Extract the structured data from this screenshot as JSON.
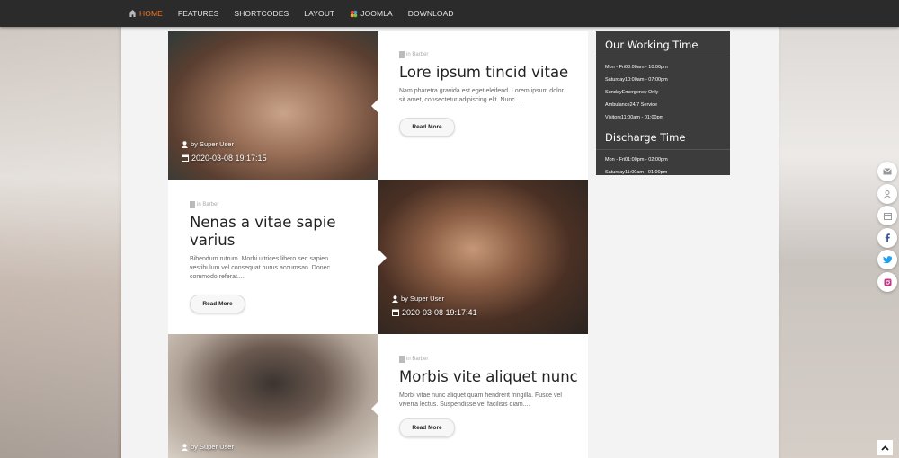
{
  "nav": {
    "items": [
      {
        "label": "HOME",
        "active": true
      },
      {
        "label": "FEATURES"
      },
      {
        "label": "SHORTCODES"
      },
      {
        "label": "LAYOUT"
      },
      {
        "label": "JOOMLA"
      },
      {
        "label": "DOWNLOAD"
      }
    ]
  },
  "posts": [
    {
      "category": "in Barber",
      "title": "Lore ipsum tincid vitae",
      "excerpt": "Nam pharetra gravida est eget eleifend. Lorem ipsum dolor sit amet, consectetur adipiscing elit. Nunc....",
      "button": "Read More",
      "author": "by Super User",
      "date": "2020-03-08 19:17:15"
    },
    {
      "category": "in Barber",
      "title": "Nenas a vitae sapie varius",
      "excerpt": "Bibendum rutrum. Morbi ultrices libero sed sapien vestibulum vel consequat purus accumsan. Donec commodo referat....",
      "button": "Read More",
      "author": "by Super User",
      "date": "2020-03-08 19:17:41"
    },
    {
      "category": "in Barber",
      "title": "Morbis vite aliquet nunc",
      "excerpt": "Morbi vitae nunc aliquet quam hendrerit fringilla. Fusce vel viverra lectus. Suspendisse vel facilisis diam....",
      "button": "Read More",
      "author": "by Super User"
    }
  ],
  "sidebar": {
    "working_title": "Our Working Time",
    "working_rows": [
      "Mon - Fri08:00am - 10:00pm",
      "Saturday10:00am - 07:00pm",
      "SundayEmergency Only",
      "Ambulance24/7 Service",
      "Visitors11:00am - 01:00pm"
    ],
    "discharge_title": "Discharge Time",
    "discharge_rows": [
      "Mon - Fri01:00pm - 02:00pm",
      "Saturday11:00am - 01:00pm"
    ]
  },
  "social": [
    "mail-icon",
    "user-icon",
    "calendar-icon",
    "facebook-icon",
    "twitter-icon",
    "instagram-icon"
  ],
  "colors": {
    "accent": "#f07a2a",
    "nav_bg": "#2b2b2b",
    "sidebar_bg": "#3c3c3c",
    "facebook": "#3b5998",
    "twitter": "#1da1f2",
    "instagram": "#c13584"
  }
}
